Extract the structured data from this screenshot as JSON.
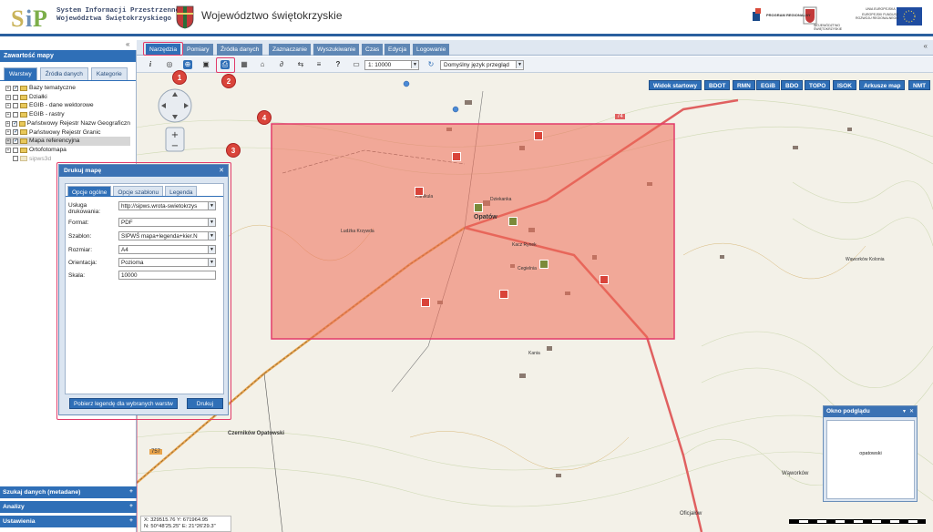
{
  "header": {
    "system_title": "System Informacji Przestrzennej\nWojewództwa Świętokrzyskiego",
    "system_title_line1": "System Informacji Przestrzennej",
    "system_title_line2": "Województwa Świętokrzyskiego",
    "app_title": "Województwo świętokrzyskie",
    "eu_program": "PROGRAM REGIONALNY",
    "eu_region": "WOJEWÓDZTWO ŚWIĘTOKRZYSKIE",
    "eu_union": "UNIA EUROPEJSKA",
    "eu_fund": "EUROPEJSKI FUNDUSZ ROZWOJU REGIONALNEGO"
  },
  "sidebar": {
    "title": "Zawartość mapy",
    "tabs": [
      "Warstwy",
      "Źródła danych",
      "Kategorie"
    ],
    "layers": [
      {
        "label": "Bazy tematyczne",
        "checked": true
      },
      {
        "label": "Działki",
        "checked": false
      },
      {
        "label": "EGIB - dane wektorowe",
        "checked": false
      },
      {
        "label": "EGIB - rastry",
        "checked": false
      },
      {
        "label": "Państwowy Rejestr Nazw Geograficzn",
        "checked": true
      },
      {
        "label": "Państwowy Rejestr Granic",
        "checked": true
      },
      {
        "label": "Mapa referencyjna",
        "checked": true
      },
      {
        "label": "Ortofotomapa",
        "checked": false
      },
      {
        "label": "sipws3d",
        "checked": false
      }
    ],
    "bottom_panels": [
      "Szukaj danych (metadane)",
      "Analizy",
      "Ustawienia"
    ]
  },
  "menubar": {
    "items": [
      "Narzędzia",
      "Pomiary",
      "Źródła danych",
      "Zaznaczanie",
      "Wyszukiwanie",
      "Czas",
      "Edycja",
      "Logowanie"
    ]
  },
  "toolbar": {
    "scale_value": "1: 10000",
    "scale_prefix": "1:",
    "language": "Domyślny język przegląd"
  },
  "basemaps": [
    "Widok startowy",
    "BDOT",
    "RMN",
    "EGiB",
    "BDO",
    "TOPO",
    "ISOK",
    "Arkusze map",
    "NMT"
  ],
  "print_dialog": {
    "title": "Drukuj mapę",
    "tabs": [
      "Opcje ogólne",
      "Opcje szablonu",
      "Legenda"
    ],
    "fields": {
      "service_label": "Usługa drukowania:",
      "service_value": "http://sipws.wrota-swietokrzys",
      "format_label": "Format:",
      "format_value": "PDF",
      "template_label": "Szablon:",
      "template_value": "SIPWŚ mapa+legenda+kier.N",
      "size_label": "Rozmiar:",
      "size_value": "A4",
      "orientation_label": "Orientacja:",
      "orientation_value": "Pozioma",
      "scale_label": "Skala:",
      "scale_value": "10000"
    },
    "legend_button": "Pobierz legendę dla wybranych warstw",
    "print_button": "Drukuj"
  },
  "preview": {
    "title": "Okno podglądu",
    "content": "opatowski"
  },
  "coords": {
    "line1": "X: 329515.76    Y: 671964.95",
    "line2": "N: 50°48'25.25\"    E: 21°26'29.3\""
  },
  "annotations": [
    "1",
    "2",
    "3",
    "4"
  ],
  "map_labels": [
    "Opatów",
    "Kanikula",
    "Dziekanka",
    "Ludźka Krzywda",
    "Kacz Rynek",
    "Cegielnia",
    "Kania",
    "Czerników Opatowski",
    "Wąworków Kolonia",
    "Wąworków",
    "Oficjałów",
    "757",
    "74"
  ]
}
